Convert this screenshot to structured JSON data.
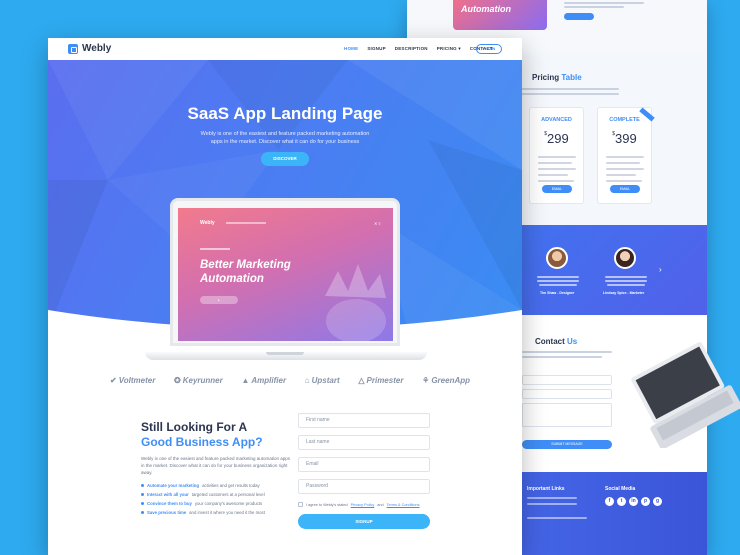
{
  "nav": {
    "logo": "Webly",
    "items": [
      {
        "label": "HOME",
        "active": true
      },
      {
        "label": "SIGNUP",
        "active": false
      },
      {
        "label": "DESCRIPTION",
        "active": false
      },
      {
        "label": "PRICING ▾",
        "active": false
      },
      {
        "label": "CONTACT",
        "active": false
      }
    ],
    "login": "LOGIN"
  },
  "hero": {
    "title": "SaaS App Landing Page",
    "subtitle": "Webly is one of the easiest and feature packed marketing automation apps in the market. Discover what it can do for your business",
    "button": "DISCOVER"
  },
  "laptop": {
    "logo": "Webly",
    "headline_1": "Better Marketing",
    "headline_2": "Automation"
  },
  "brands": [
    "Voltmeter",
    "Keyrunner",
    "Amplifier",
    "Upstart",
    "Primester",
    "GreenApp"
  ],
  "cta": {
    "title_1": "Still Looking For A",
    "title_2": "Good Business App?",
    "description": "Webly is one of the easiest and feature packed marketing automation apps in the market. Discover what it can do for your business organization right away.",
    "bullets": [
      {
        "bold": "Automate your marketing",
        "rest": "activities and get results today"
      },
      {
        "bold": "Interact with all your",
        "rest": "targeted customers at a personal level"
      },
      {
        "bold": "Convince them to buy",
        "rest": "your company's awesome products"
      },
      {
        "bold": "Save precious time",
        "rest": "and invest it where you need it the most"
      }
    ]
  },
  "form": {
    "first_name": "First name",
    "last_name": "Last name",
    "email": "Email",
    "password": "Password",
    "agree_prefix": "I agree to Webly's stated",
    "privacy": "Privacy Policy",
    "and": "and",
    "terms": "Terms & Conditions",
    "submit": "SIGNUP"
  },
  "sheet": {
    "hero_word": "Automation",
    "pricing_title": "Pricing",
    "pricing_title_accent": "Table",
    "plans": [
      {
        "name": "ADVANCED",
        "price": "299",
        "currency": "$"
      },
      {
        "name": "COMPLETE",
        "price": "399",
        "currency": "$"
      }
    ],
    "plan_button": "EMAIL",
    "testimonials": [
      {
        "name": "Tim Shaw - Designer"
      },
      {
        "name": "Lindsay Spice - Marketer"
      }
    ],
    "contact_title": "Contact",
    "contact_title_accent": "Us",
    "contact_button": "SUBMIT MESSAGE",
    "footer_links_title": "Important Links",
    "footer_social_title": "Social Media",
    "social": [
      "f",
      "t",
      "in",
      "p",
      "g"
    ]
  },
  "colors": {
    "accent": "#3f8ef7",
    "hero_start": "#5a6ef0",
    "hero_end": "#3a8cf3",
    "background": "#2eaaf0",
    "button_cyan": "#3cb4f8"
  }
}
